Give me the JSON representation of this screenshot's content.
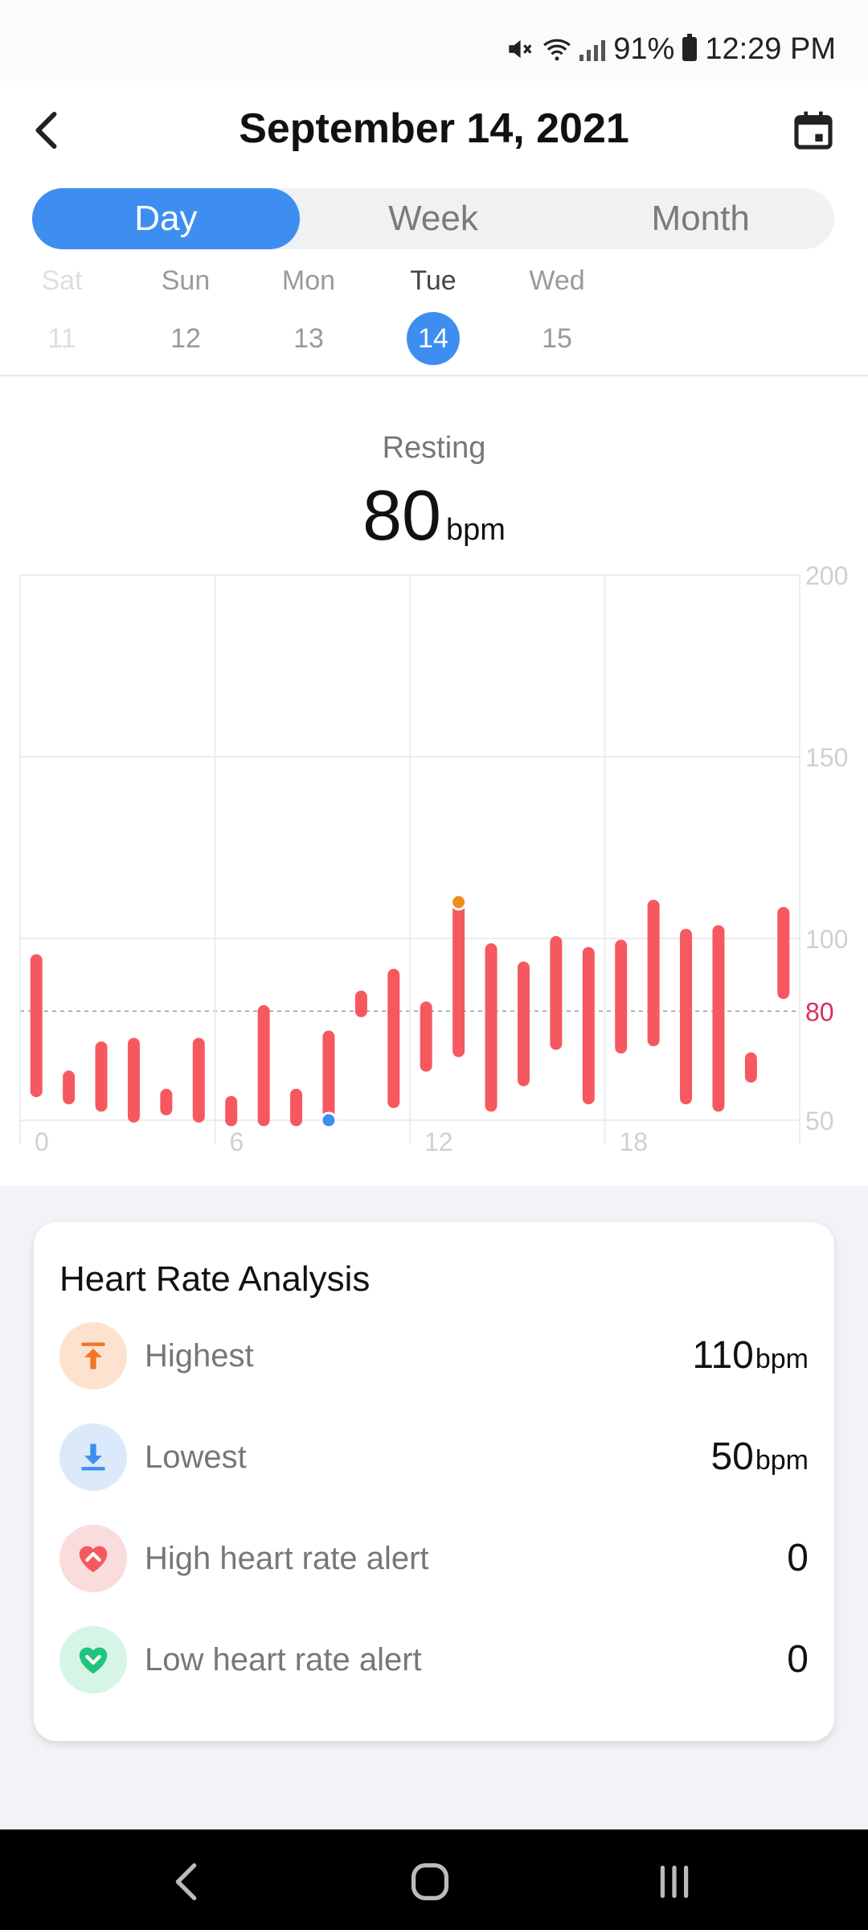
{
  "status_bar": {
    "battery": "91%",
    "time": "12:29 PM"
  },
  "header": {
    "title": "September 14, 2021"
  },
  "tabs": [
    {
      "label": "Day",
      "active": true
    },
    {
      "label": "Week",
      "active": false
    },
    {
      "label": "Month",
      "active": false
    }
  ],
  "date_strip": [
    {
      "weekday": "Sat",
      "day": "11"
    },
    {
      "weekday": "Sun",
      "day": "12"
    },
    {
      "weekday": "Mon",
      "day": "13"
    },
    {
      "weekday": "Tue",
      "day": "14"
    },
    {
      "weekday": "Wed",
      "day": "15"
    }
  ],
  "resting": {
    "label": "Resting",
    "value": "80",
    "unit": "bpm"
  },
  "chart_data": {
    "type": "bar",
    "y_ticks": [
      "200",
      "150",
      "100",
      "80",
      "50"
    ],
    "x_ticks": [
      "0",
      "6",
      "12",
      "18"
    ],
    "ylim": [
      50,
      200
    ],
    "xlim": [
      0,
      24
    ],
    "reference_line": 80,
    "bars": [
      {
        "x": 0.5,
        "low": 58,
        "high": 94
      },
      {
        "x": 1.5,
        "low": 56,
        "high": 62
      },
      {
        "x": 2.5,
        "low": 54,
        "high": 70
      },
      {
        "x": 3.5,
        "low": 51,
        "high": 71
      },
      {
        "x": 4.5,
        "low": 53,
        "high": 57
      },
      {
        "x": 5.5,
        "low": 51,
        "high": 71
      },
      {
        "x": 6.5,
        "low": 50,
        "high": 55
      },
      {
        "x": 7.5,
        "low": 50,
        "high": 80
      },
      {
        "x": 8.5,
        "low": 50,
        "high": 57
      },
      {
        "x": 9.5,
        "low": 50,
        "high": 73
      },
      {
        "x": 10.5,
        "low": 80,
        "high": 84
      },
      {
        "x": 11.5,
        "low": 55,
        "high": 90
      },
      {
        "x": 12.5,
        "low": 65,
        "high": 81
      },
      {
        "x": 13.5,
        "low": 69,
        "high": 110
      },
      {
        "x": 14.5,
        "low": 54,
        "high": 97
      },
      {
        "x": 15.5,
        "low": 61,
        "high": 92
      },
      {
        "x": 16.5,
        "low": 71,
        "high": 99
      },
      {
        "x": 17.5,
        "low": 56,
        "high": 96
      },
      {
        "x": 18.5,
        "low": 70,
        "high": 98
      },
      {
        "x": 19.5,
        "low": 72,
        "high": 109
      },
      {
        "x": 20.5,
        "low": 56,
        "high": 101
      },
      {
        "x": 21.5,
        "low": 54,
        "high": 102
      },
      {
        "x": 22.5,
        "low": 62,
        "high": 67
      },
      {
        "x": 23.5,
        "low": 85,
        "high": 107
      }
    ],
    "max_point": {
      "x": 13.5,
      "y": 110,
      "color": "#f08c1e"
    },
    "min_point": {
      "x": 9.5,
      "y": 50,
      "color": "#3d8ef0"
    },
    "bar_color": "#f5595f",
    "reference_color": "#d9305c"
  },
  "analysis": {
    "title": "Heart Rate Analysis",
    "rows": [
      {
        "label": "Highest",
        "value": "110",
        "unit": "bpm",
        "icon": "arrow-up-icon"
      },
      {
        "label": "Lowest",
        "value": "50",
        "unit": "bpm",
        "icon": "arrow-down-icon"
      },
      {
        "label": "High heart rate alert",
        "value": "0",
        "unit": "",
        "icon": "heart-up-icon"
      },
      {
        "label": "Low heart rate alert",
        "value": "0",
        "unit": "",
        "icon": "heart-down-icon"
      }
    ]
  }
}
